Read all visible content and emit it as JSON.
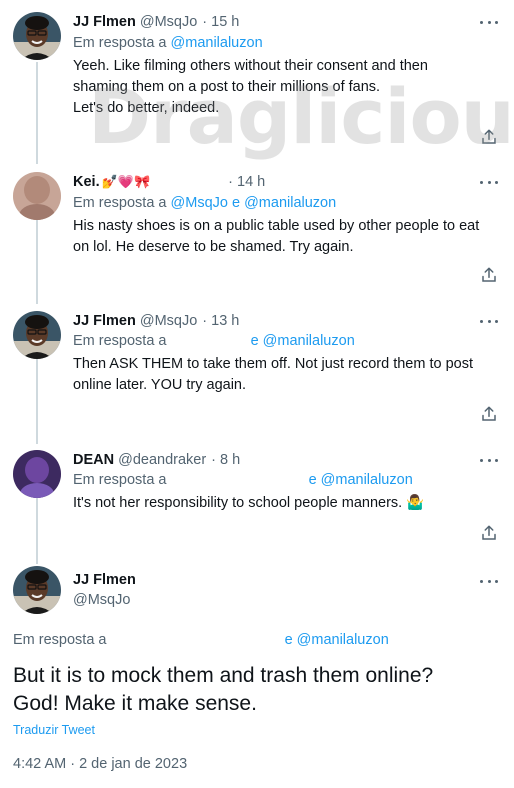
{
  "tweets": [
    {
      "name": "JJ Flmen",
      "handle": "@MsqJo",
      "sep": "·",
      "time": "15 h",
      "reply_prefix": "Em resposta a",
      "reply_link": "@manilaluzon",
      "body": [
        "Yeeh. Like filming others without their consent and then",
        "shaming them on a post to their millions of fans.",
        "Let's do better, indeed."
      ]
    },
    {
      "name": "Kei.",
      "emojis": "💅💗🎀",
      "time": "· 14 h",
      "reply_prefix": "Em resposta a",
      "reply_link": "@MsqJo e @manilaluzon",
      "body": [
        "His nasty shoes is on a public table used by other people to eat",
        "on lol. He deserve to be shamed. Try again."
      ]
    },
    {
      "name": "JJ Flmen",
      "handle": "@MsqJo",
      "sep": "·",
      "time": "13 h",
      "reply_prefix": "Em resposta a",
      "reply_link": "e @manilaluzon",
      "body": [
        "Then ASK THEM to take them off. Not just record them to post",
        "online later. YOU try again."
      ]
    },
    {
      "name": "DEAN",
      "handle": "@deandraker",
      "sep": "·",
      "time": "8 h",
      "reply_prefix": "Em resposta a",
      "reply_link": "e @manilaluzon",
      "body": [
        "It's not her responsibility to school people manners. 🤷‍♂️"
      ]
    }
  ],
  "focus": {
    "name": "JJ Flmen",
    "handle": "@MsqJo",
    "reply_prefix": "Em resposta a",
    "reply_link": "e @manilaluzon",
    "body": [
      "But it is to mock them and trash them online?",
      "God! Make it make sense."
    ],
    "translate": "Traduzir Tweet",
    "timestamp": "4:42 AM · 2 de jan de 2023"
  },
  "watermark": "Draglicious",
  "icons": {
    "more": "more-icon",
    "share": "share-icon"
  },
  "colors": {
    "link": "#1d9bf0",
    "muted": "#536471",
    "text": "#0f1419",
    "thread_line": "#cfd9de"
  }
}
